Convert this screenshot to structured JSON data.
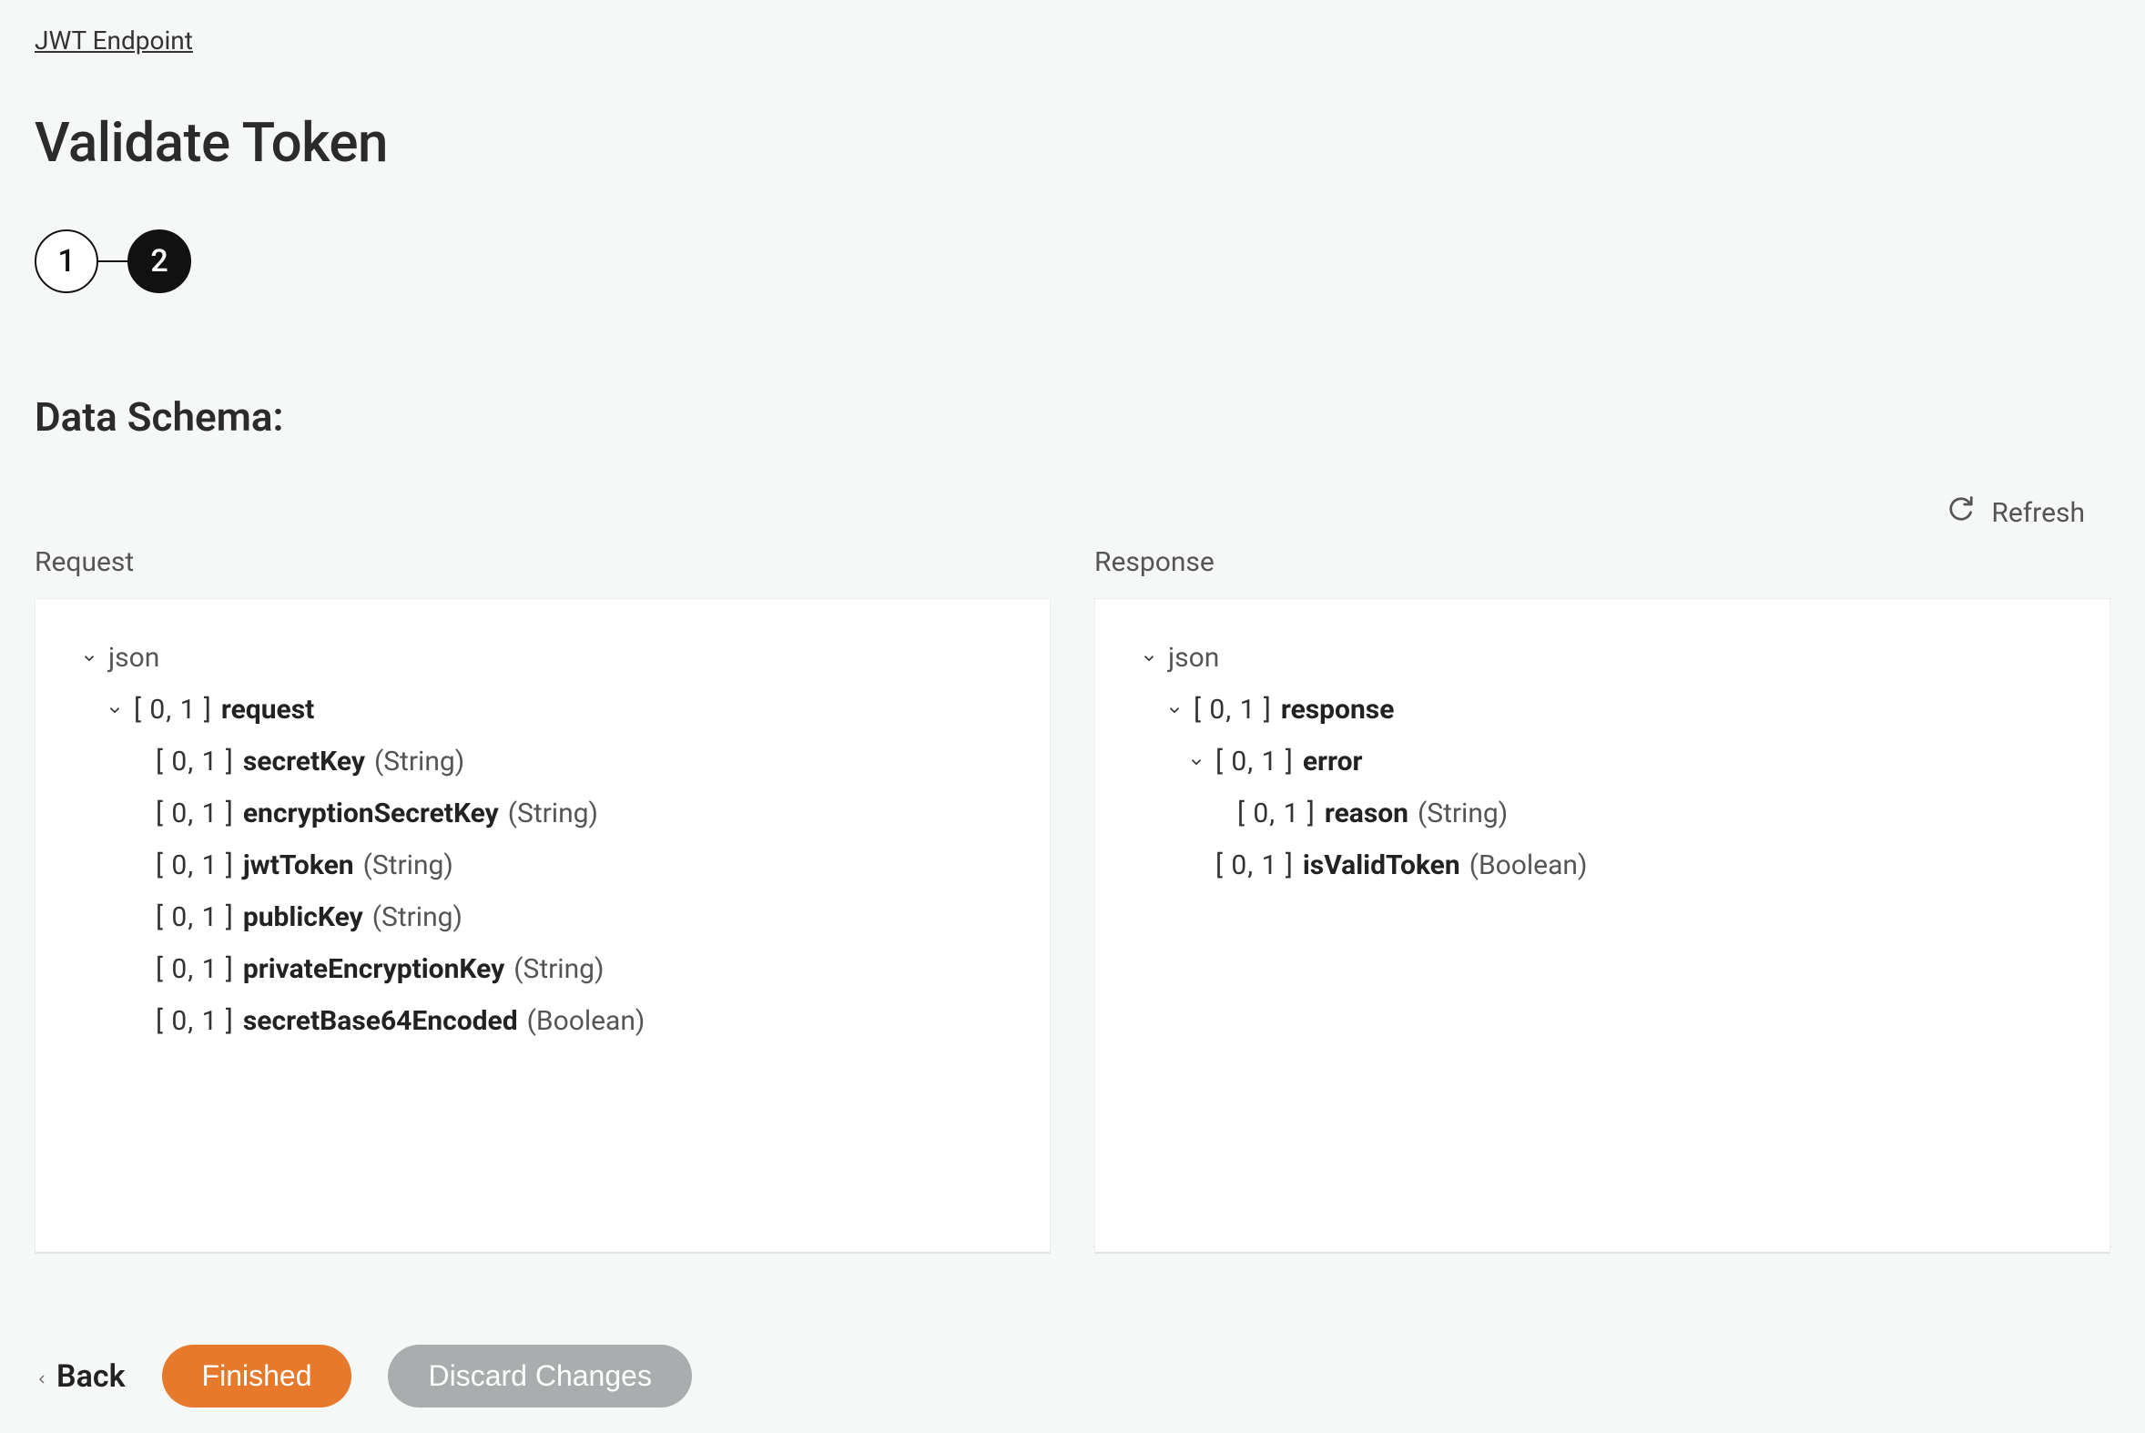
{
  "breadcrumb": "JWT Endpoint",
  "title": "Validate Token",
  "stepper": {
    "step1": "1",
    "step2": "2"
  },
  "section_title": "Data Schema:",
  "refresh_label": "Refresh",
  "panels": {
    "request_label": "Request",
    "response_label": "Response"
  },
  "request_tree": {
    "root": "json",
    "object": {
      "bracket": "[ 0, 1 ]",
      "name": "request"
    },
    "fields": [
      {
        "bracket": "[ 0, 1 ]",
        "name": "secretKey",
        "type": "(String)"
      },
      {
        "bracket": "[ 0, 1 ]",
        "name": "encryptionSecretKey",
        "type": "(String)"
      },
      {
        "bracket": "[ 0, 1 ]",
        "name": "jwtToken",
        "type": "(String)"
      },
      {
        "bracket": "[ 0, 1 ]",
        "name": "publicKey",
        "type": "(String)"
      },
      {
        "bracket": "[ 0, 1 ]",
        "name": "privateEncryptionKey",
        "type": "(String)"
      },
      {
        "bracket": "[ 0, 1 ]",
        "name": "secretBase64Encoded",
        "type": "(Boolean)"
      }
    ]
  },
  "response_tree": {
    "root": "json",
    "object": {
      "bracket": "[ 0, 1 ]",
      "name": "response"
    },
    "error": {
      "bracket": "[ 0, 1 ]",
      "name": "error"
    },
    "error_fields": [
      {
        "bracket": "[ 0, 1 ]",
        "name": "reason",
        "type": "(String)"
      }
    ],
    "root_fields": [
      {
        "bracket": "[ 0, 1 ]",
        "name": "isValidToken",
        "type": "(Boolean)"
      }
    ]
  },
  "actions": {
    "back": "Back",
    "finished": "Finished",
    "discard": "Discard Changes"
  }
}
